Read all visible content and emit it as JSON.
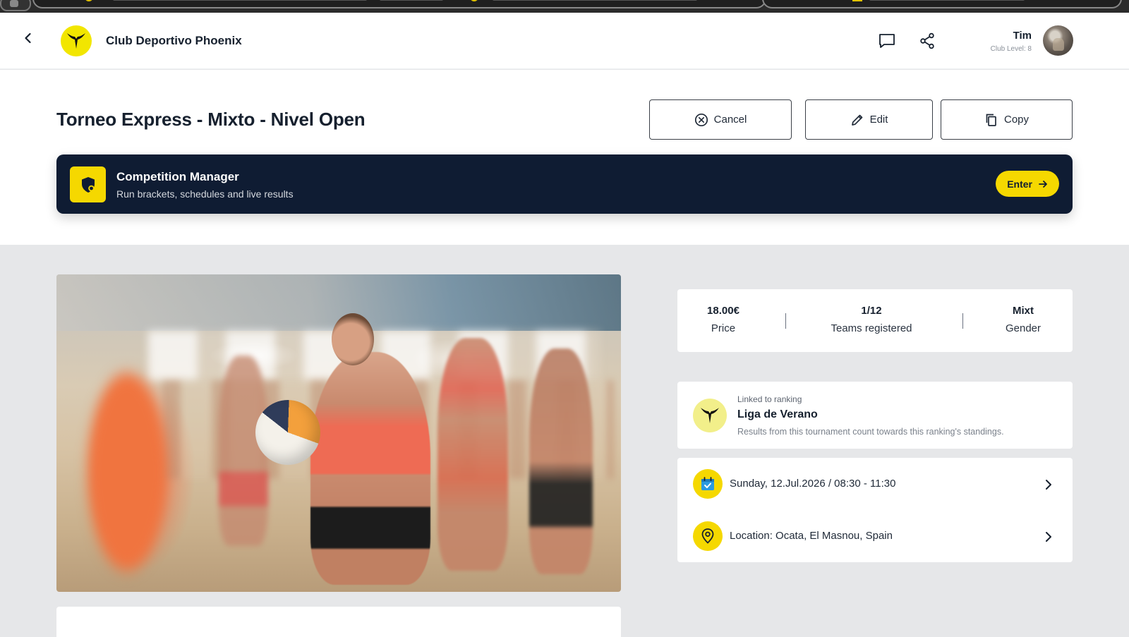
{
  "header": {
    "club_name": "Club Deportivo Phoenix",
    "user_name": "Tim",
    "user_level": "Club Level: 8"
  },
  "title": "Torneo Express - Mixto - Nivel Open",
  "actions": {
    "cancel_label": "Cancel",
    "edit_label": "Edit",
    "copy_label": "Copy"
  },
  "competition_manager": {
    "title": "Competition Manager",
    "subtitle": "Run brackets, schedules and live results",
    "enter_label": "Enter"
  },
  "stats": {
    "price_value": "18.00€",
    "price_label": "Price",
    "teams_value": "1/12",
    "teams_label": "Teams registered",
    "gender_value": "Mixt",
    "gender_label": "Gender"
  },
  "ranking": {
    "caption": "Linked to ranking",
    "name": "Liga de Verano",
    "description": "Results from this tournament count towards this ranking's standings."
  },
  "details": {
    "date_text": "Sunday, 12.Jul.2026 / 08:30 - 11:30",
    "location_text": "Location: Ocata, El Masnou, Spain"
  },
  "colors": {
    "accent_yellow": "#f5d800",
    "banner_navy": "#0f1c33",
    "page_background": "#e6e7e9"
  },
  "icons": {
    "back": "chevron-left-icon",
    "club_logo": "phoenix-logo-icon",
    "chat": "chat-bubble-icon",
    "share": "share-icon",
    "cancel": "circle-x-icon",
    "edit": "pencil-icon",
    "copy": "copy-icon",
    "competition_manager": "shield-icon",
    "enter": "arrow-right-icon",
    "date": "calendar-check-icon",
    "location": "map-pin-icon",
    "row_chevron": "chevron-right-icon"
  }
}
